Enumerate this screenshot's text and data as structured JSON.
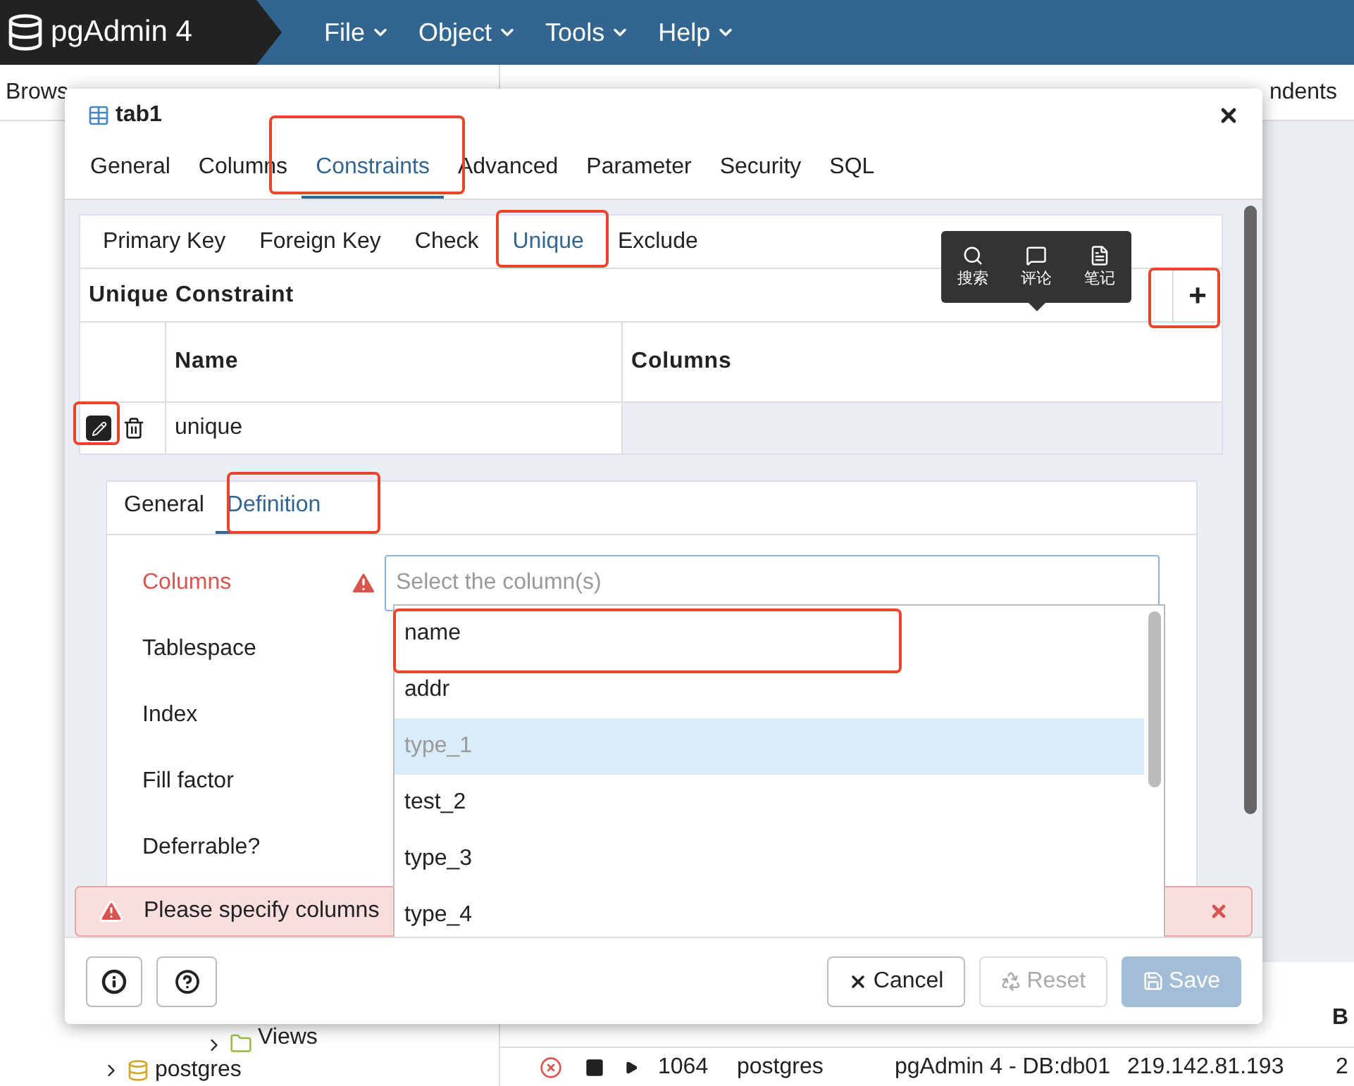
{
  "app": {
    "title": "pgAdmin 4",
    "menus": [
      "File",
      "Object",
      "Tools",
      "Help"
    ]
  },
  "browser": {
    "title": "Brows",
    "tree": [
      {
        "label": "Views"
      },
      {
        "label": "postgres"
      }
    ]
  },
  "main_tabs_visible": "ndents",
  "activity": {
    "column_header": "B",
    "row": {
      "pid": "1064",
      "user": "postgres",
      "app": "pgAdmin 4 - DB:db01",
      "client": "219.142.81.193",
      "extra": "2"
    }
  },
  "dialog": {
    "title": "tab1",
    "tabs": [
      {
        "label": "General",
        "selected": false
      },
      {
        "label": "Columns",
        "selected": false
      },
      {
        "label": "Constraints",
        "selected": true
      },
      {
        "label": "Advanced",
        "selected": false
      },
      {
        "label": "Parameter",
        "selected": false
      },
      {
        "label": "Security",
        "selected": false
      },
      {
        "label": "SQL",
        "selected": false
      }
    ],
    "subtabs": [
      {
        "label": "Primary Key",
        "selected": false
      },
      {
        "label": "Foreign Key",
        "selected": false
      },
      {
        "label": "Check",
        "selected": false
      },
      {
        "label": "Unique",
        "selected": true
      },
      {
        "label": "Exclude",
        "selected": false
      }
    ],
    "section_title": "Unique Constraint",
    "add_button": "+",
    "table": {
      "columns": [
        "Name",
        "Columns"
      ],
      "rows": [
        {
          "name": "unique",
          "columns": ""
        }
      ]
    },
    "detail_tabs": [
      {
        "label": "General",
        "selected": false
      },
      {
        "label": "Definition",
        "selected": true
      }
    ],
    "form": [
      {
        "label": "Columns",
        "error": true
      },
      {
        "label": "Tablespace",
        "error": false
      },
      {
        "label": "Index",
        "error": false
      },
      {
        "label": "Fill factor",
        "error": false
      },
      {
        "label": "Deferrable?",
        "error": false
      }
    ],
    "columns_field": {
      "placeholder": "Select the column(s)"
    },
    "options": [
      {
        "label": "name",
        "selected": false,
        "disabled": false
      },
      {
        "label": "addr",
        "selected": false,
        "disabled": false
      },
      {
        "label": "type_1",
        "selected": true,
        "disabled": true
      },
      {
        "label": "test_2",
        "selected": false,
        "disabled": false
      },
      {
        "label": "type_3",
        "selected": false,
        "disabled": false
      },
      {
        "label": "type_4",
        "selected": false,
        "disabled": false
      }
    ],
    "error_message": "Please specify columns",
    "buttons": [
      {
        "label": "Cancel",
        "kind": "cancel",
        "disabled": false
      },
      {
        "label": "Reset",
        "kind": "reset",
        "disabled": true
      },
      {
        "label": "Save",
        "kind": "save",
        "disabled": true
      }
    ]
  },
  "tooltip": {
    "items": [
      {
        "label": "搜索",
        "kind": "search"
      },
      {
        "label": "评论",
        "kind": "comment"
      },
      {
        "label": "笔记",
        "kind": "note"
      }
    ]
  }
}
